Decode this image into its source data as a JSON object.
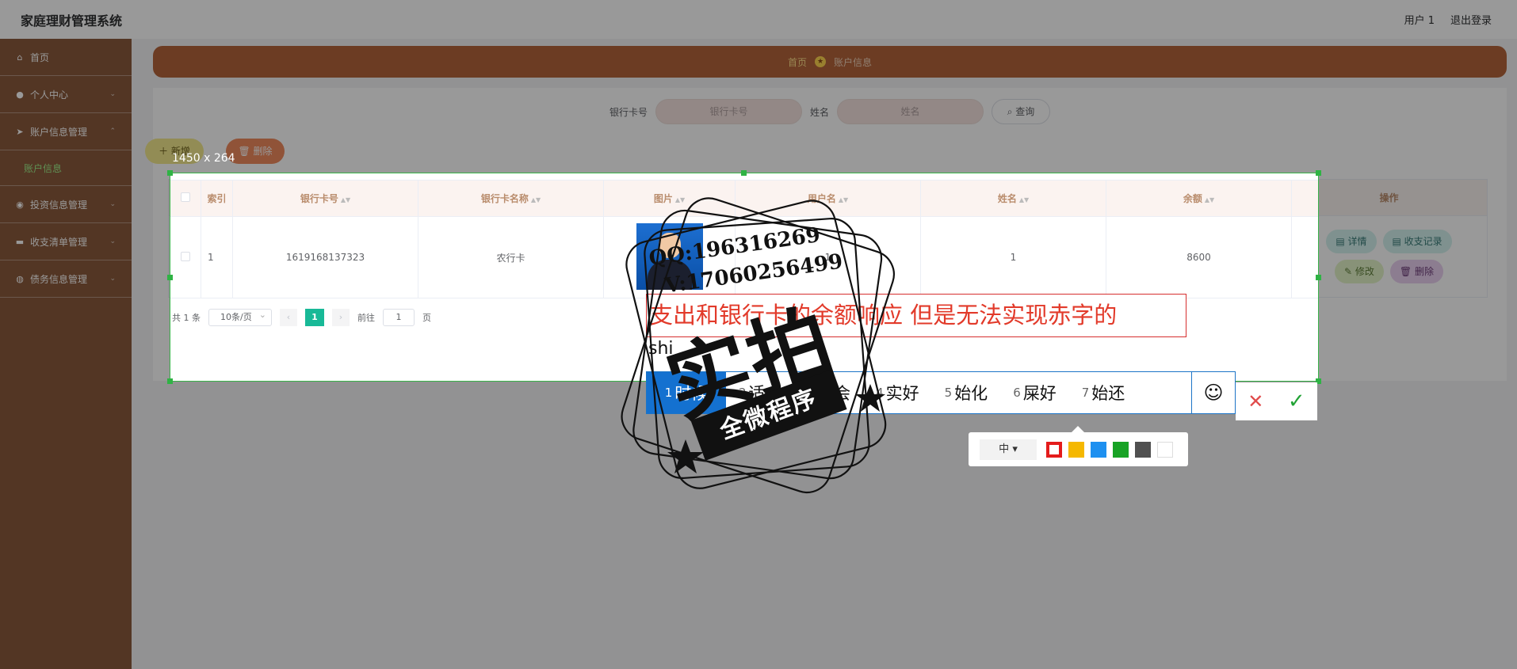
{
  "app": {
    "title": "家庭理财管理系统"
  },
  "topbar": {
    "user": "用户 1",
    "logout": "退出登录"
  },
  "sidebar": {
    "items": [
      {
        "label": "首页",
        "icon": "home-icon"
      },
      {
        "label": "个人中心",
        "icon": "user-icon"
      },
      {
        "label": "账户信息管理",
        "icon": "send-icon"
      },
      {
        "label": "投资信息管理",
        "icon": "location-icon"
      },
      {
        "label": "收支清单管理",
        "icon": "chat-icon"
      },
      {
        "label": "债务信息管理",
        "icon": "globe-icon"
      }
    ],
    "sub_item": "账户信息"
  },
  "breadcrumb": {
    "home": "首页",
    "current": "账户信息"
  },
  "search": {
    "card_label": "银行卡号",
    "card_placeholder": "银行卡号",
    "name_label": "姓名",
    "name_placeholder": "姓名",
    "query_button": "查询"
  },
  "toolbar": {
    "add": "新增",
    "delete": "删除"
  },
  "table": {
    "headers": [
      "索引",
      "银行卡号",
      "银行卡名称",
      "图片",
      "用户名",
      "姓名",
      "余额",
      "操作"
    ],
    "rows": [
      {
        "index": "1",
        "card_no": "1619168137323",
        "card_name": "农行卡",
        "username": "1",
        "name": "1",
        "balance": "8600"
      }
    ],
    "actions": {
      "detail": "详情",
      "records": "收支记录",
      "edit": "修改",
      "delete": "删除"
    }
  },
  "pagination": {
    "total": "共 1 条",
    "page_size": "10条/页",
    "current": "1",
    "goto_prefix": "前往",
    "goto_value": "1",
    "goto_suffix": "页"
  },
  "screenshot_tool": {
    "size_label": "1450 x 264",
    "annotation_text": "支出和银行卡的余额响应 但是无法实现赤字的",
    "ime_composition": "shi",
    "candidates": [
      {
        "num": "1",
        "text": "时候"
      },
      {
        "num": "2",
        "text": "适合"
      },
      {
        "num": "3",
        "text": "试会"
      },
      {
        "num": "4",
        "text": "实好"
      },
      {
        "num": "5",
        "text": "始化"
      },
      {
        "num": "6",
        "text": "屎好"
      },
      {
        "num": "7",
        "text": "始还"
      }
    ],
    "font_size": "中",
    "colors": [
      "#e41c1c",
      "#f5b800",
      "#1e90f0",
      "#18a325",
      "#505050",
      "#ffffff"
    ]
  },
  "watermark": {
    "line1": "QQ:196316269",
    "line2": "V:17060256499",
    "big_text": "实拍",
    "ribbon_text": "全微程序"
  }
}
